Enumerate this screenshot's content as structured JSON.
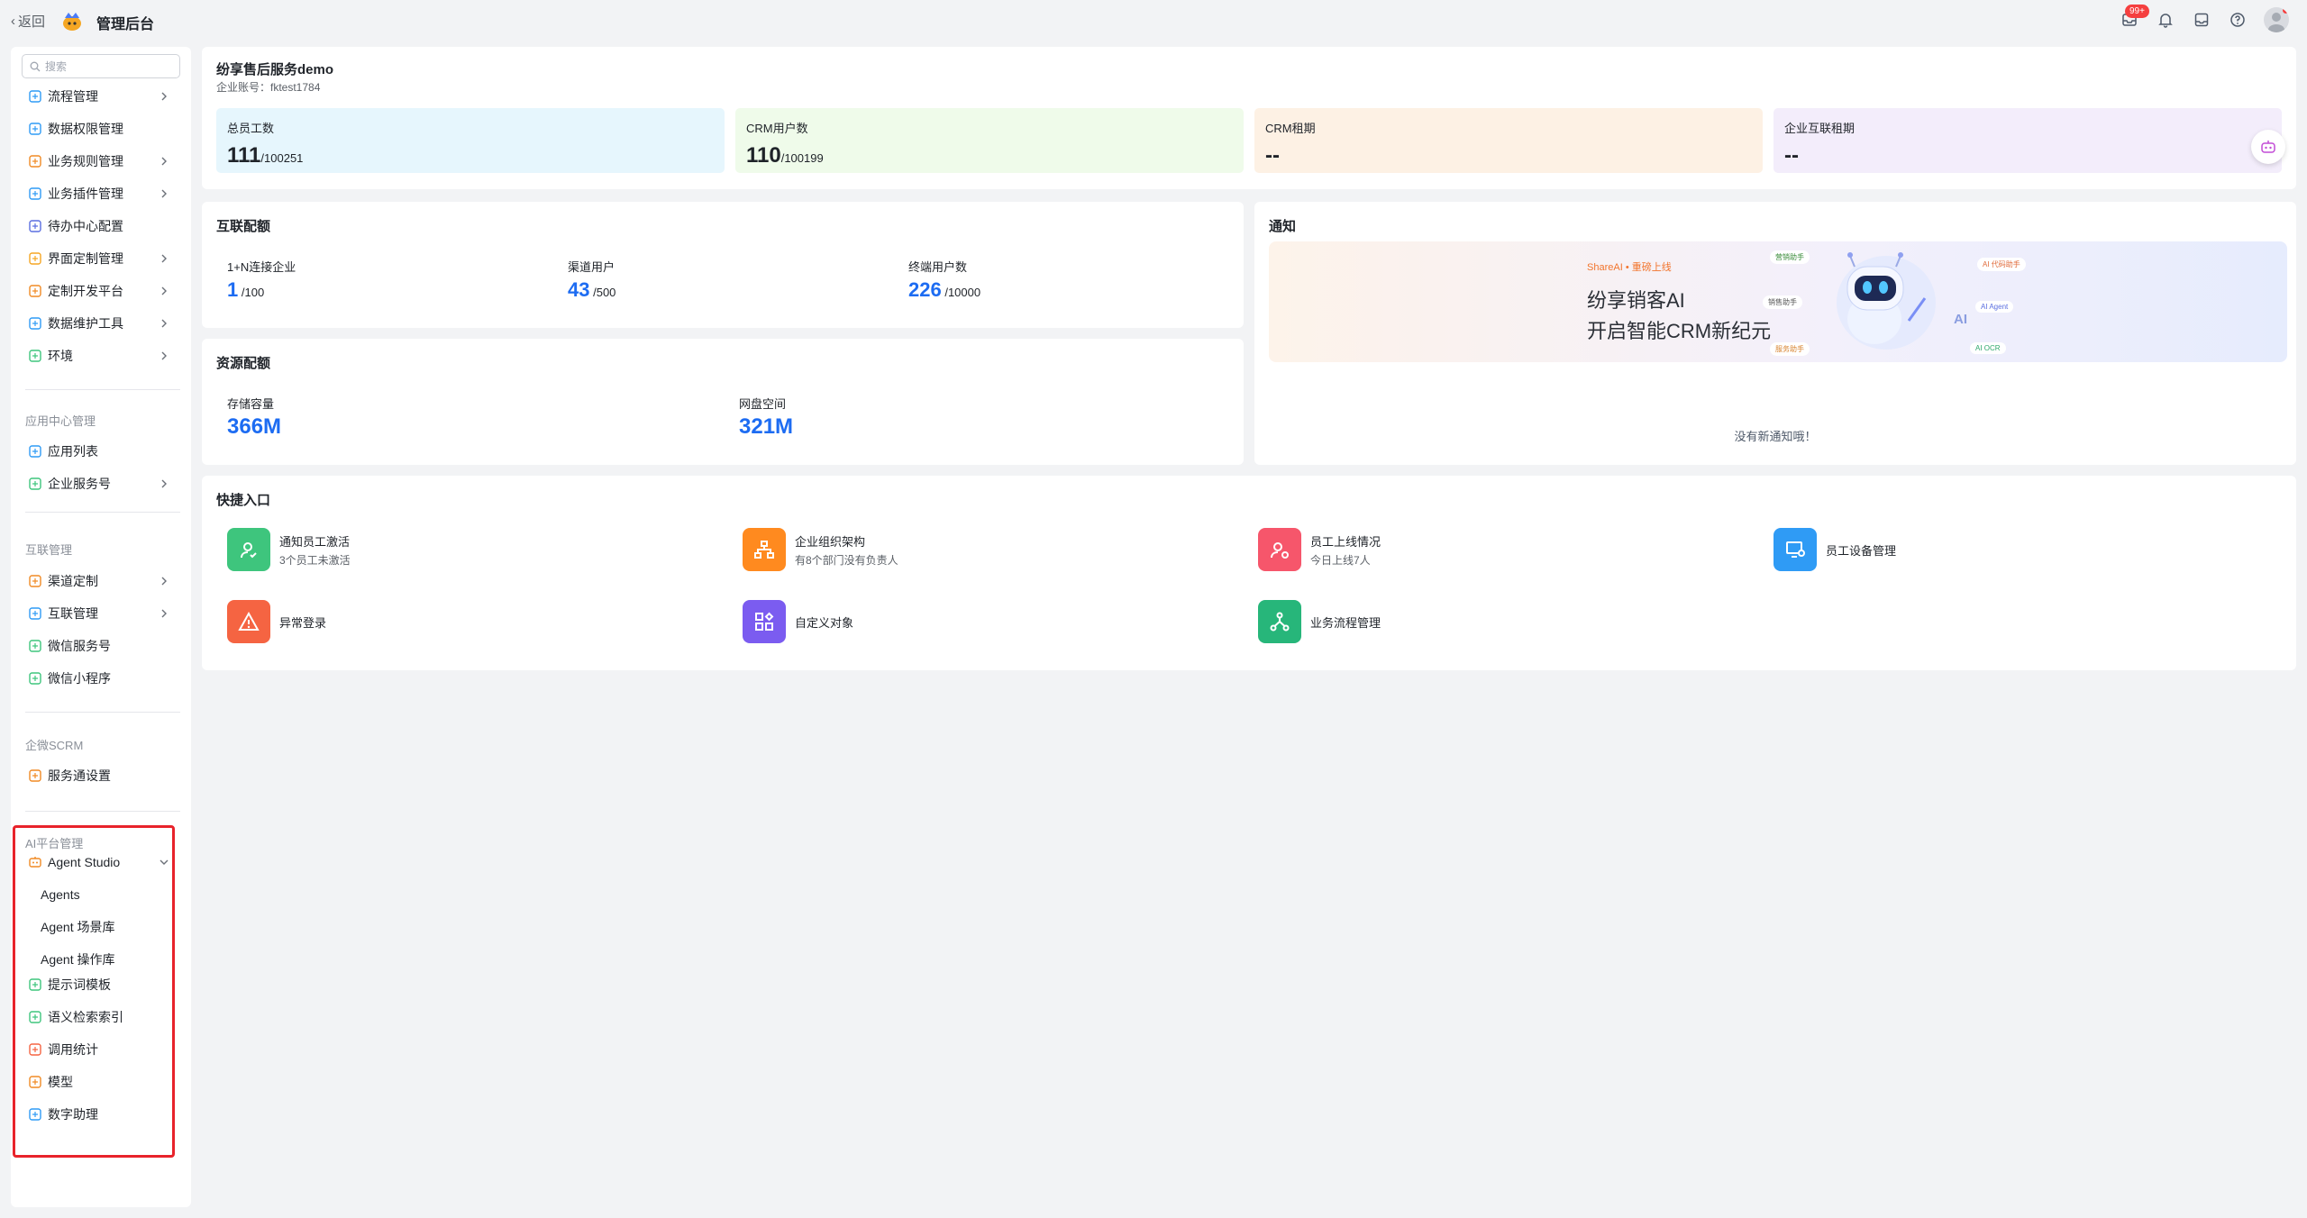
{
  "topbar": {
    "back_label": "返回",
    "title": "管理后台",
    "notification_badge": "99+"
  },
  "sidebar": {
    "search_placeholder": "搜索",
    "items_top": [
      {
        "label": "流程管理",
        "icon": "flow-icon",
        "chevron": true
      },
      {
        "label": "数据权限管理",
        "icon": "data-permission-icon",
        "chevron": false
      },
      {
        "label": "业务规则管理",
        "icon": "wrench-icon",
        "chevron": true
      },
      {
        "label": "业务插件管理",
        "icon": "plugin-icon",
        "chevron": true
      },
      {
        "label": "待办中心配置",
        "icon": "flag-icon",
        "chevron": false
      },
      {
        "label": "界面定制管理",
        "icon": "layout-icon",
        "chevron": true
      },
      {
        "label": "定制开发平台",
        "icon": "dev-icon",
        "chevron": true
      },
      {
        "label": "数据维护工具",
        "icon": "chart-icon",
        "chevron": true
      },
      {
        "label": "环境",
        "icon": "env-icon",
        "chevron": true
      }
    ],
    "app_center": {
      "label": "应用中心管理",
      "items": [
        {
          "label": "应用列表",
          "icon": "grid-icon",
          "chevron": false
        },
        {
          "label": "企业服务号",
          "icon": "service-icon",
          "chevron": true
        }
      ]
    },
    "interconnect": {
      "label": "互联管理",
      "items": [
        {
          "label": "渠道定制",
          "icon": "channel-icon",
          "chevron": true
        },
        {
          "label": "互联管理",
          "icon": "link-icon",
          "chevron": true
        },
        {
          "label": "微信服务号",
          "icon": "wechat-icon",
          "chevron": false
        },
        {
          "label": "微信小程序",
          "icon": "miniprogram-icon",
          "chevron": false
        }
      ]
    },
    "scrm": {
      "label": "企微SCRM",
      "items": [
        {
          "label": "服务通设置",
          "icon": "settings-doc-icon",
          "chevron": false
        }
      ]
    },
    "ai_platform": {
      "label": "AI平台管理",
      "agent_studio": "Agent Studio",
      "sub_items": [
        "Agents",
        "Agent 场景库",
        "Agent 操作库"
      ],
      "items": [
        {
          "label": "提示词模板",
          "icon": "template-icon"
        },
        {
          "label": "语义检索索引",
          "icon": "index-icon"
        },
        {
          "label": "调用统计",
          "icon": "stats-icon"
        },
        {
          "label": "模型",
          "icon": "model-icon"
        },
        {
          "label": "数字助理",
          "icon": "assistant-icon"
        }
      ]
    }
  },
  "corp": {
    "name": "纷享售后服务demo",
    "account": "企业账号：fktest1784"
  },
  "stats": [
    {
      "label": "总员工数",
      "value": "111",
      "total": "/100251",
      "bg": "#e6f6fd"
    },
    {
      "label": "CRM用户数",
      "value": "110",
      "total": "/100199",
      "bg": "#effbea"
    },
    {
      "label": "CRM租期",
      "value": "--",
      "total": "",
      "bg": "#fdf1e4"
    },
    {
      "label": "企业互联租期",
      "value": "--",
      "total": "",
      "bg": "#f3edfb"
    }
  ],
  "interconnect_quota": {
    "title": "互联配额",
    "items": [
      {
        "label": "1+N连接企业",
        "value": "1",
        "total": "/100"
      },
      {
        "label": "渠道用户",
        "value": "43",
        "total": "/500"
      },
      {
        "label": "终端用户数",
        "value": "226",
        "total": "/10000"
      }
    ]
  },
  "resource_quota": {
    "title": "资源配额",
    "items": [
      {
        "label": "存储容量",
        "value": "366M"
      },
      {
        "label": "网盘空间",
        "value": "321M"
      }
    ]
  },
  "notice": {
    "title": "通知",
    "banner": {
      "tag_left": "ShareAI",
      "tag_right": "重磅上线",
      "line1": "纷享销客AI",
      "line2": "开启智能CRM新纪元",
      "bubbles": [
        "营销助手",
        "销售助手",
        "服务助手",
        "AI Agent",
        "AI OCR",
        "AI 代码助手"
      ],
      "robot_label": "AI"
    },
    "empty_text": "没有新通知哦！"
  },
  "quick_entry": {
    "title": "快捷入口",
    "items": [
      {
        "title": "通知员工激活",
        "sub": "3个员工未激活",
        "color": "#3ec57d",
        "icon": "user-check-icon"
      },
      {
        "title": "企业组织架构",
        "sub": "有8个部门没有负责人",
        "color": "#ff8a1f",
        "icon": "org-chart-icon"
      },
      {
        "title": "员工上线情况",
        "sub": "今日上线7人",
        "color": "#f6566b",
        "icon": "user-online-icon"
      },
      {
        "title": "员工设备管理",
        "sub": "",
        "color": "#2f9bf5",
        "icon": "device-icon"
      },
      {
        "title": "异常登录",
        "sub": "",
        "color": "#f56442",
        "icon": "warning-icon"
      },
      {
        "title": "自定义对象",
        "sub": "",
        "color": "#7b5cf0",
        "icon": "custom-object-icon"
      },
      {
        "title": "业务流程管理",
        "sub": "",
        "color": "#27b67a",
        "icon": "workflow-icon"
      }
    ]
  }
}
